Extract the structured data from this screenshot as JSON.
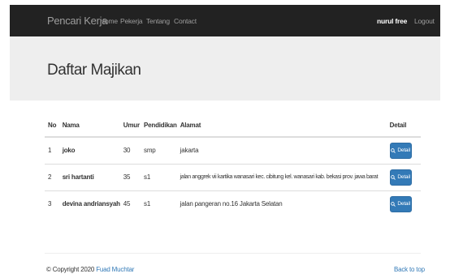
{
  "navbar": {
    "brand": "Pencari Kerja",
    "links": [
      "Home",
      "Pekerja",
      "Tentang",
      "Contact"
    ],
    "user_name": "nurul free",
    "logout": "Logout"
  },
  "jumbotron": {
    "title": "Daftar Majikan"
  },
  "table": {
    "headers": [
      "No",
      "Nama",
      "Umur",
      "Pendidikan",
      "Alamat",
      "Detail"
    ],
    "rows": [
      {
        "no": "1",
        "nama": "joko",
        "umur": "30",
        "pendidikan": "smp",
        "alamat": "jakarta",
        "detail": "Detail"
      },
      {
        "no": "2",
        "nama": "sri hartanti",
        "umur": "35",
        "pendidikan": "s1",
        "alamat": "jalan anggrek vii kartika wanasari kec. cibitung kel. wanasari kab. bekasi prov. jawa barat",
        "detail": "Detail"
      },
      {
        "no": "3",
        "nama": "devina andriansyah",
        "umur": "45",
        "pendidikan": "s1",
        "alamat": "jalan pangeran no.16 Jakarta Selatan",
        "detail": "Detail"
      }
    ]
  },
  "footer": {
    "copyright": "© Copyright 2020",
    "author": "Fuad Muchtar",
    "back_to_top": "Back to top"
  },
  "colors": {
    "navbar": "#222222",
    "jumbotron": "#eeeeee",
    "primary": "#337ab7"
  },
  "icons": {
    "detail_button": "search-icon"
  }
}
